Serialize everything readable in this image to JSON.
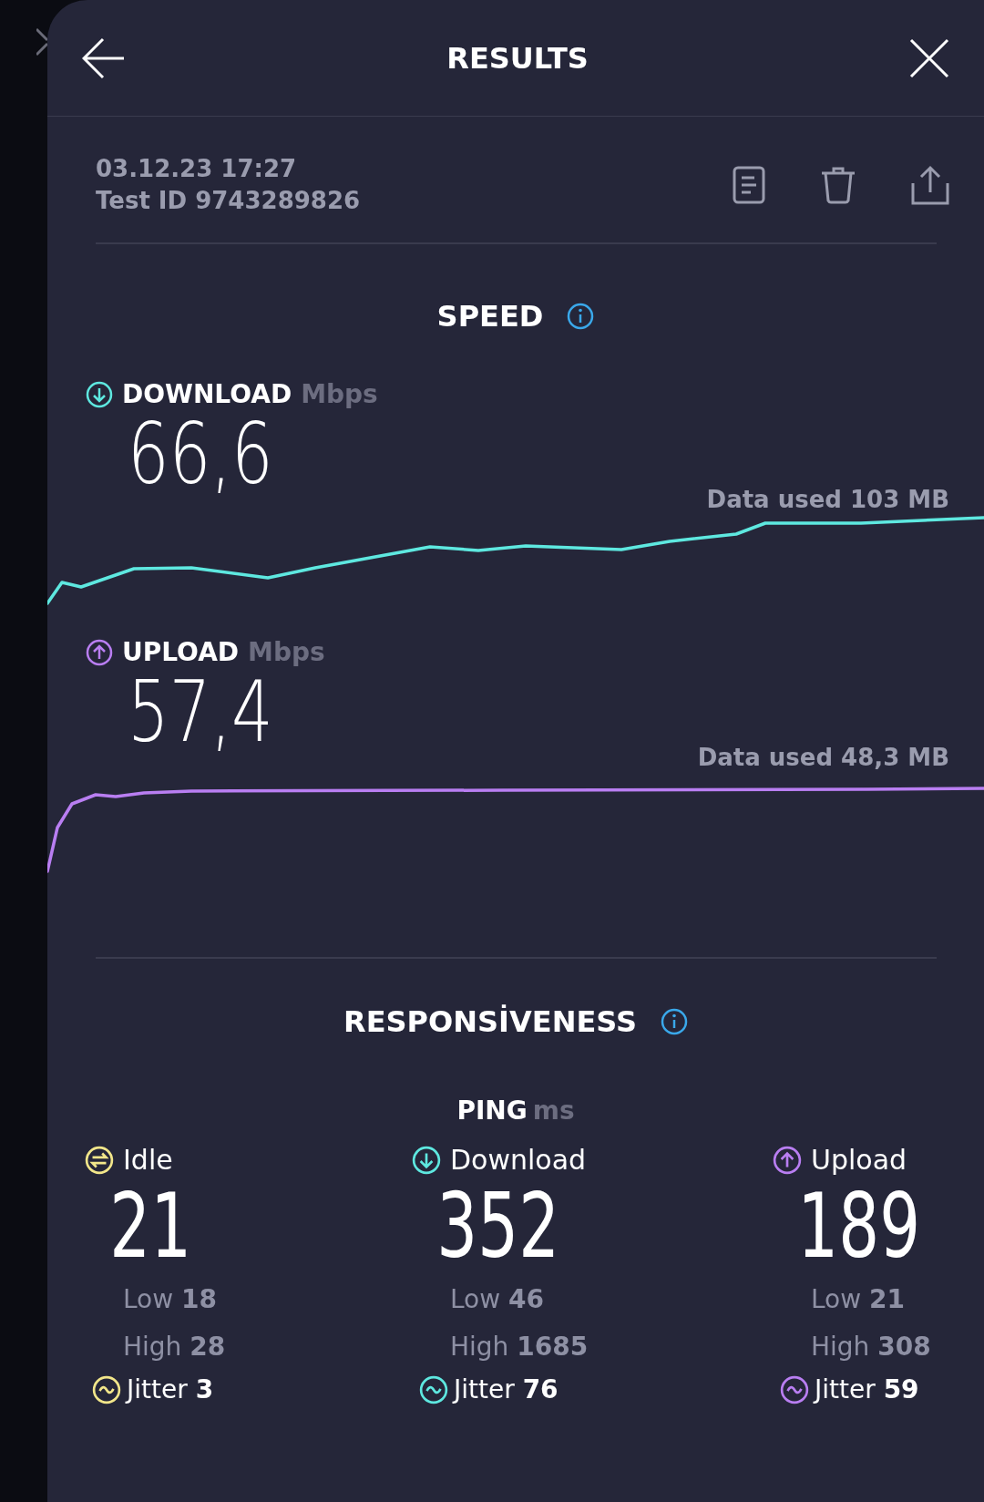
{
  "header": {
    "title": "RESULTS"
  },
  "test": {
    "date": "03.12.23 17:27",
    "test_id": "Test ID 9743289826"
  },
  "speed": {
    "title": "SPEED",
    "metrics": [
      {
        "kind": "download",
        "label": "DOWNLOAD",
        "unit": "Mbps",
        "value": "66,6",
        "data_used": "Data used 103 MB",
        "color": "#5ee8e0"
      },
      {
        "kind": "upload",
        "label": "UPLOAD",
        "unit": "Mbps",
        "value": "57,4",
        "data_used": "Data used 48,3 MB",
        "color": "#b97ef2"
      }
    ]
  },
  "responsiveness": {
    "title": "RESPONSİVENESS",
    "ping": {
      "label": "PING",
      "unit": "ms"
    },
    "columns": [
      {
        "kind": "idle",
        "label": "Idle",
        "value": "21",
        "low": "Low **18**",
        "high": "High **28**",
        "jitter": "Jitter **3**",
        "color": "#f2e68a"
      },
      {
        "kind": "download",
        "label": "Download",
        "value": "352",
        "low": "Low **46**",
        "high": "High **1685**",
        "jitter": "Jitter **76**",
        "color": "#5ee8e0"
      },
      {
        "kind": "upload",
        "label": "Upload",
        "value": "189",
        "low": "Low **21**",
        "high": "High **308**",
        "jitter": "Jitter **59**",
        "color": "#b97ef2"
      }
    ]
  }
}
